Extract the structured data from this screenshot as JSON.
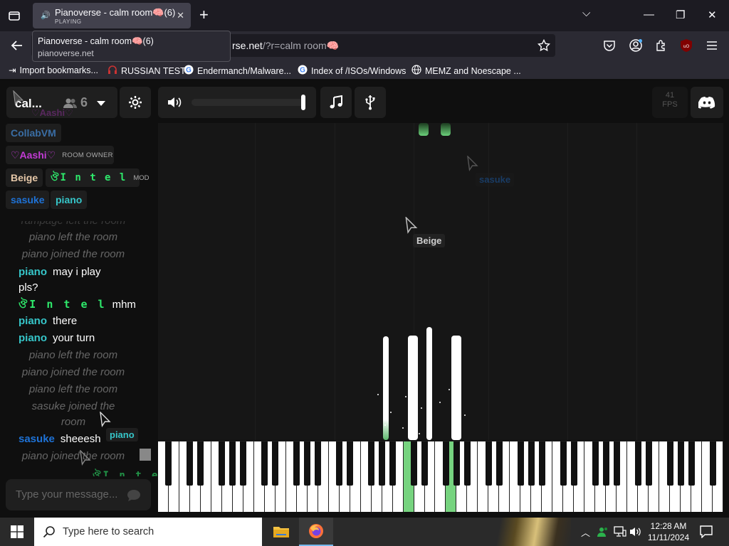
{
  "browser": {
    "tab": {
      "title": "Pianoverse - calm room🧠(6)",
      "status": "PLAYING"
    },
    "tooltip": {
      "title": "Pianoverse - calm room🧠(6)",
      "domain": "pianoverse.net"
    },
    "url": {
      "visible": "rse.net",
      "rest": "/?r=calm room🧠"
    },
    "bookmarks": [
      {
        "label": "Import bookmarks...",
        "icon": "import-icon"
      },
      {
        "label": "RUSSIAN TEST",
        "icon": "headphones-icon"
      },
      {
        "label": "Endermanch/Malware...",
        "icon": "google-icon"
      },
      {
        "label": "Index of /ISOs/Windows",
        "icon": "google-icon"
      },
      {
        "label": "MEMZ and Noescape ...",
        "icon": "globe-icon"
      }
    ]
  },
  "app": {
    "room_name": "cal...",
    "user_count": "6",
    "fps": {
      "value": "41",
      "label": "FPS"
    },
    "volume_level": 1.0,
    "users": [
      {
        "name": "CollabVM",
        "color": "#3a6ea5",
        "tag": ""
      },
      {
        "name": "♡Aashi♡",
        "color": "#c23bd4",
        "tag": "ROOM OWNER"
      },
      {
        "name": "Beige",
        "color": "#e6c8a8",
        "tag": ""
      },
      {
        "name": "ঔI n t e l",
        "color": "#2ee86b",
        "tag": "MOD"
      },
      {
        "name": "sasuke",
        "color": "#1e72d6",
        "tag": ""
      },
      {
        "name": "piano",
        "color": "#36c6c9",
        "tag": ""
      }
    ],
    "chat": [
      {
        "type": "system",
        "text": "rampage left the room"
      },
      {
        "type": "system",
        "text": "piano left the room"
      },
      {
        "type": "system",
        "text": "piano joined the room"
      },
      {
        "type": "msg",
        "name": "piano",
        "text": "may i play pls?"
      },
      {
        "type": "msg",
        "name": "ঔI n t e l",
        "text": "mhm"
      },
      {
        "type": "msg",
        "name": "piano",
        "text": "there"
      },
      {
        "type": "msg",
        "name": "piano",
        "text": "your turn"
      },
      {
        "type": "system",
        "text": "piano left the room"
      },
      {
        "type": "system",
        "text": "piano joined the room"
      },
      {
        "type": "system",
        "text": "piano left the room"
      },
      {
        "type": "system",
        "text": "sasuke joined the room"
      },
      {
        "type": "msg",
        "name": "sasuke",
        "text": "sheeesh"
      },
      {
        "type": "system",
        "text": "piano joined the room"
      }
    ],
    "chat_placeholder": "Type your message...",
    "cursors": [
      {
        "name": "sasuke",
        "color": "#1e72d6"
      },
      {
        "name": "Beige",
        "color": "#cfcfcf"
      },
      {
        "name": "piano",
        "color": "#36c6c9"
      },
      {
        "name": "ঔI n t e l",
        "color": "#2ee86b"
      },
      {
        "name": "♡Aashi♡",
        "color": "#c23bd4"
      }
    ]
  },
  "taskbar": {
    "search_placeholder": "Type here to search",
    "time": "12:28 AM",
    "date": "11/11/2024"
  }
}
